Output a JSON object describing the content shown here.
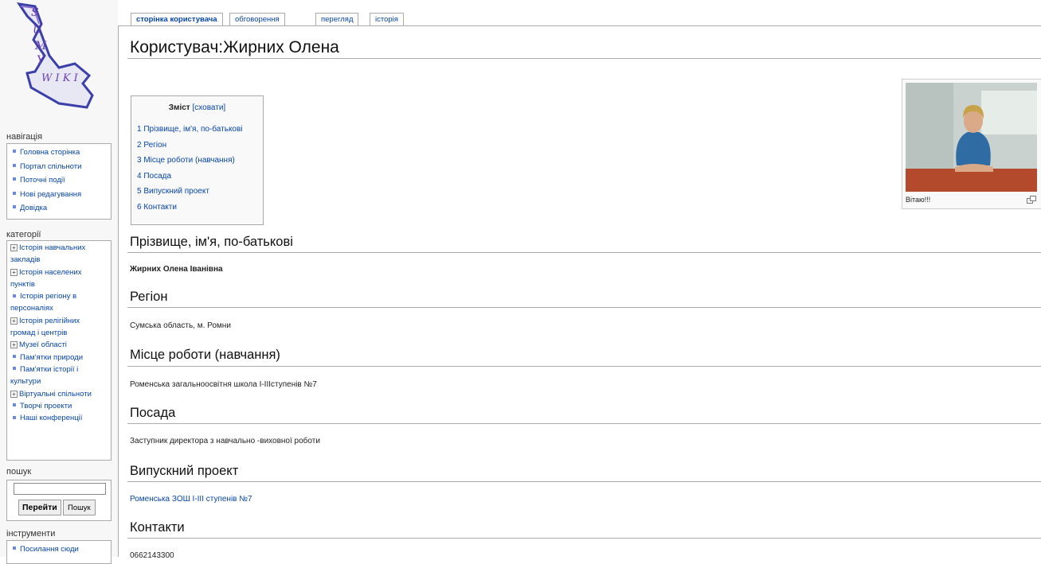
{
  "logo": {
    "letters": [
      "S",
      "U",
      "M",
      "Y",
      "W I K I"
    ]
  },
  "sidebar": {
    "navigation": {
      "heading": "навігація",
      "items": [
        "Головна сторінка",
        "Портал спільноти",
        "Поточні події",
        "Нові редагування",
        "Довідка"
      ]
    },
    "categories": {
      "heading": "категорії",
      "items": [
        {
          "label": "Історія навчальних закладів",
          "expandable": true
        },
        {
          "label": "Історія населених пунктів",
          "expandable": true
        },
        {
          "label": "Історія регіону в персоналіях",
          "expandable": false
        },
        {
          "label": "Історія релігійних громад і центрів",
          "expandable": true
        },
        {
          "label": "Музеї області",
          "expandable": true
        },
        {
          "label": "Пам'ятки природи",
          "expandable": false
        },
        {
          "label": "Пам'ятки історії і культури",
          "expandable": false
        },
        {
          "label": "Віртуальні спільноти",
          "expandable": true
        },
        {
          "label": "Творчі проекти",
          "expandable": false
        },
        {
          "label": "Наші конференції",
          "expandable": false
        }
      ]
    },
    "search": {
      "heading": "пошук",
      "input_value": "",
      "go_label": "Перейти",
      "search_label": "Пошук"
    },
    "tools": {
      "heading": "інструменти",
      "items": [
        "Посилання сюди"
      ]
    }
  },
  "tabs": [
    {
      "label": "сторінка користувача",
      "active": true
    },
    {
      "label": "обговорення",
      "active": false
    },
    {
      "label": "перегляд",
      "active": false
    },
    {
      "label": "історія",
      "active": false
    }
  ],
  "page": {
    "title": "Користувач:Жирних Олена",
    "toc": {
      "title": "Зміст",
      "toggle": "[сховати]",
      "items": [
        "1 Прізвище, ім'я, по-батькові",
        "2 Регіон",
        "3 Місце роботи (навчання)",
        "4 Посада",
        "5 Випускний проект",
        "6 Контакти"
      ]
    },
    "thumb": {
      "caption": "Вітаю!!!"
    },
    "sections": [
      {
        "heading": "Прізвище, ім'я, по-батькові",
        "text": "Жирних Олена Іванівна"
      },
      {
        "heading": "Регіон",
        "text": "Сумська область, м. Ромни"
      },
      {
        "heading": "Місце роботи (навчання)",
        "text": "Роменська загальноосвітня школа І-ІІІступенів №7"
      },
      {
        "heading": "Посада",
        "text": "Заступник директора з навчально -виховної роботи"
      },
      {
        "heading": "Випускний проект",
        "text": "Роменська ЗОШ І-ІІІ ступенів №7"
      },
      {
        "heading": "Контакти",
        "text": "0662143300"
      }
    ]
  }
}
